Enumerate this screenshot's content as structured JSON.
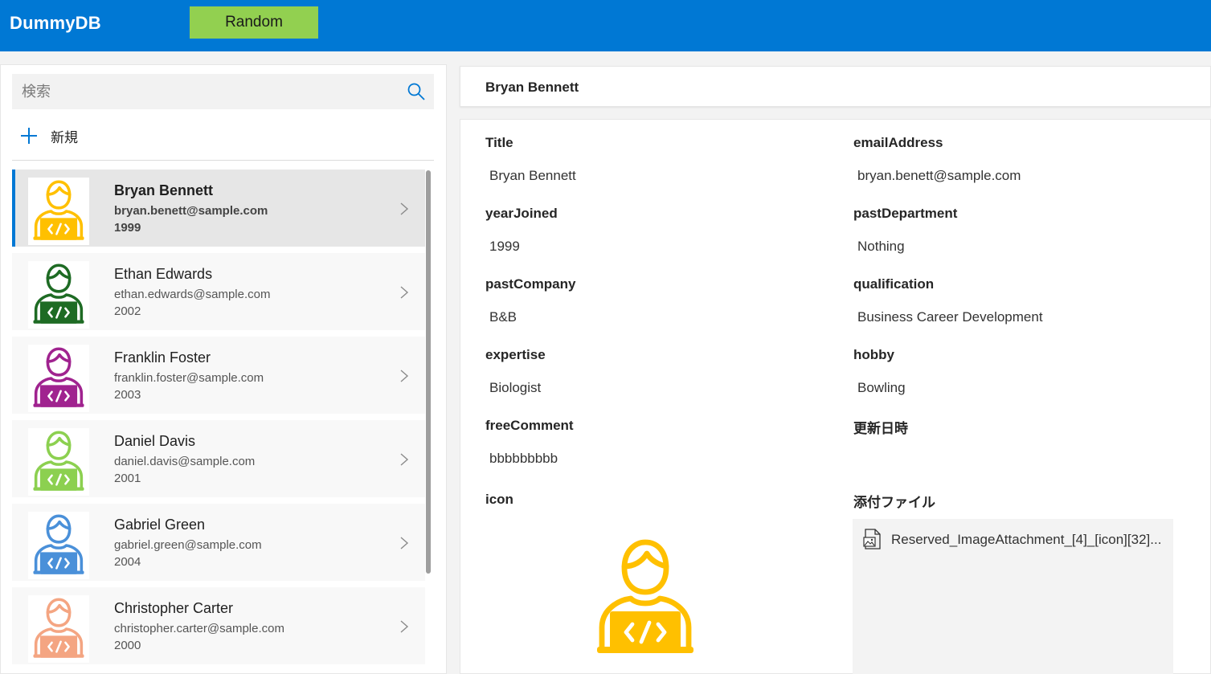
{
  "app": {
    "title": "DummyDB"
  },
  "toolbar": {
    "random_label": "Random"
  },
  "search": {
    "placeholder": "検索"
  },
  "new_button": {
    "label": "新規"
  },
  "list": [
    {
      "name": "Bryan Bennett",
      "email": "bryan.benett@sample.com",
      "year": "1999",
      "color": "#ffc000",
      "selected": true
    },
    {
      "name": "Ethan Edwards",
      "email": "ethan.edwards@sample.com",
      "year": "2002",
      "color": "#1e6b24",
      "selected": false
    },
    {
      "name": "Franklin Foster",
      "email": "franklin.foster@sample.com",
      "year": "2003",
      "color": "#a0238f",
      "selected": false
    },
    {
      "name": "Daniel Davis",
      "email": "daniel.davis@sample.com",
      "year": "2001",
      "color": "#8cd050",
      "selected": false
    },
    {
      "name": "Gabriel Green",
      "email": "gabriel.green@sample.com",
      "year": "2004",
      "color": "#4a90d9",
      "selected": false
    },
    {
      "name": "Christopher Carter",
      "email": "christopher.carter@sample.com",
      "year": "2000",
      "color": "#f4a582",
      "selected": false
    }
  ],
  "detail": {
    "header": "Bryan Bennett",
    "fields": {
      "title": {
        "label": "Title",
        "value": "Bryan Bennett"
      },
      "email": {
        "label": "emailAddress",
        "value": "bryan.benett@sample.com"
      },
      "year_joined": {
        "label": "yearJoined",
        "value": "1999"
      },
      "past_department": {
        "label": "pastDepartment",
        "value": "Nothing"
      },
      "past_company": {
        "label": "pastCompany",
        "value": "B&B"
      },
      "qualification": {
        "label": "qualification",
        "value": "Business Career Development"
      },
      "expertise": {
        "label": "expertise",
        "value": "Biologist"
      },
      "hobby": {
        "label": "hobby",
        "value": "Bowling"
      },
      "free_comment": {
        "label": "freeComment",
        "value": "bbbbbbbbb"
      },
      "updated": {
        "label": "更新日時",
        "value": ""
      },
      "icon": {
        "label": "icon"
      },
      "attachment": {
        "label": "添付ファイル",
        "file_name": "Reserved_ImageAttachment_[4]_[icon][32]..."
      }
    }
  },
  "icons": {
    "search": "search-icon",
    "add": "plus-icon",
    "chevron": "chevron-right-icon",
    "file": "image-file-icon",
    "avatar": "developer-avatar-icon"
  },
  "colors": {
    "header": "#0078d4",
    "random_button": "#92d050",
    "accent": "#0078d4"
  }
}
